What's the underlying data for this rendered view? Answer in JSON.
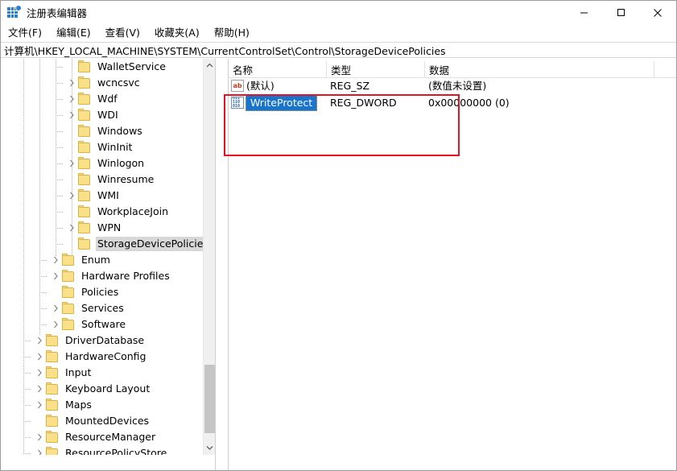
{
  "window": {
    "title": "注册表编辑器",
    "app_icon": "registry-editor-icon",
    "minimize_label": "最小化",
    "maximize_label": "最大化",
    "close_label": "关闭"
  },
  "menubar": {
    "items": [
      {
        "label": "文件(F)"
      },
      {
        "label": "编辑(E)"
      },
      {
        "label": "查看(V)"
      },
      {
        "label": "收藏夹(A)"
      },
      {
        "label": "帮助(H)"
      }
    ]
  },
  "address": {
    "path": "计算机\\HKEY_LOCAL_MACHINE\\SYSTEM\\CurrentControlSet\\Control\\StorageDevicePolicies"
  },
  "tree": {
    "items": [
      {
        "label": "WalletService",
        "depth": 3,
        "expander": "none",
        "selected": false
      },
      {
        "label": "wcncsvc",
        "depth": 3,
        "expander": "collapsed",
        "selected": false
      },
      {
        "label": "Wdf",
        "depth": 3,
        "expander": "collapsed",
        "selected": false
      },
      {
        "label": "WDI",
        "depth": 3,
        "expander": "collapsed",
        "selected": false
      },
      {
        "label": "Windows",
        "depth": 3,
        "expander": "none",
        "selected": false
      },
      {
        "label": "WinInit",
        "depth": 3,
        "expander": "none",
        "selected": false
      },
      {
        "label": "Winlogon",
        "depth": 3,
        "expander": "collapsed",
        "selected": false
      },
      {
        "label": "Winresume",
        "depth": 3,
        "expander": "none",
        "selected": false
      },
      {
        "label": "WMI",
        "depth": 3,
        "expander": "collapsed",
        "selected": false
      },
      {
        "label": "WorkplaceJoin",
        "depth": 3,
        "expander": "none",
        "selected": false
      },
      {
        "label": "WPN",
        "depth": 3,
        "expander": "collapsed",
        "selected": false
      },
      {
        "label": "StorageDevicePolicies",
        "depth": 3,
        "expander": "none",
        "selected": true
      },
      {
        "label": "Enum",
        "depth": 2,
        "expander": "collapsed",
        "selected": false
      },
      {
        "label": "Hardware Profiles",
        "depth": 2,
        "expander": "collapsed",
        "selected": false
      },
      {
        "label": "Policies",
        "depth": 2,
        "expander": "none",
        "selected": false
      },
      {
        "label": "Services",
        "depth": 2,
        "expander": "collapsed",
        "selected": false
      },
      {
        "label": "Software",
        "depth": 2,
        "expander": "collapsed",
        "selected": false
      },
      {
        "label": "DriverDatabase",
        "depth": 1,
        "expander": "collapsed",
        "selected": false
      },
      {
        "label": "HardwareConfig",
        "depth": 1,
        "expander": "collapsed",
        "selected": false
      },
      {
        "label": "Input",
        "depth": 1,
        "expander": "collapsed",
        "selected": false
      },
      {
        "label": "Keyboard Layout",
        "depth": 1,
        "expander": "collapsed",
        "selected": false
      },
      {
        "label": "Maps",
        "depth": 1,
        "expander": "collapsed",
        "selected": false
      },
      {
        "label": "MountedDevices",
        "depth": 1,
        "expander": "none",
        "selected": false
      },
      {
        "label": "ResourceManager",
        "depth": 1,
        "expander": "collapsed",
        "selected": false
      },
      {
        "label": "ResourcePolicyStore",
        "depth": 1,
        "expander": "collapsed",
        "selected": false
      }
    ]
  },
  "list": {
    "columns": [
      {
        "label": "名称"
      },
      {
        "label": "类型"
      },
      {
        "label": "数据"
      }
    ],
    "rows": [
      {
        "name": "(默认)",
        "type": "REG_SZ",
        "data": "(数值未设置)",
        "icon": "string-value-icon",
        "selected": false
      },
      {
        "name": "WriteProtect",
        "type": "REG_DWORD",
        "data": "0x00000000 (0)",
        "icon": "dword-value-icon",
        "selected": true
      }
    ]
  },
  "annotation": {
    "color": "#e81123",
    "shape": "rectangle"
  },
  "colors": {
    "selection_blue": "#1874cd",
    "tree_selection_gray": "#d8d8d8",
    "folder_yellow": "#fbe08a",
    "annotation_red": "#e81123",
    "scrollbar_thumb": "#c5c5c5"
  }
}
